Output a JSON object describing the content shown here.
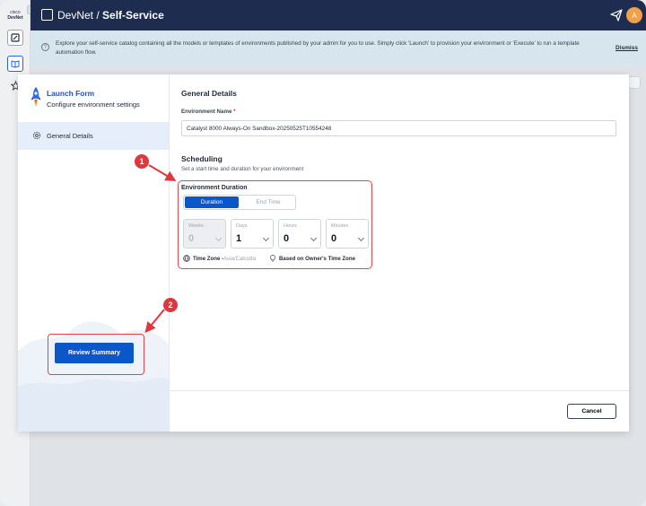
{
  "rail": {
    "logo_top": "cisco",
    "logo_bottom": "DevNet"
  },
  "header": {
    "app": "DevNet",
    "separator": " / ",
    "section": "Self-Service",
    "avatar_initial": "A"
  },
  "banner": {
    "text": "Explore your self-service catalog containing all the models or templates of environments published by your admin for you to use. Simply click 'Launch' to provision your environment or 'Execute' to run a template automation flow.",
    "dismiss": "Dismiss"
  },
  "sidebar": {
    "title": "Launch Form",
    "subtitle": "Configure environment settings",
    "nav_item": "General Details",
    "review_button": "Review Summary"
  },
  "main": {
    "section_title": "General Details",
    "env_name_label": "Environment Name",
    "required_mark": "*",
    "env_name_value": "Catalyst 8000 Always-On Sandbox-20250525T10554248",
    "scheduling_title": "Scheduling",
    "scheduling_sub": "Set a start time and duration for your environment",
    "duration_title": "Environment Duration",
    "tabs": {
      "duration": "Duration",
      "end_time": "End Time"
    },
    "selects": [
      {
        "label": "Weeks",
        "value": "0"
      },
      {
        "label": "Days",
        "value": "1"
      },
      {
        "label": "Hours",
        "value": "0"
      },
      {
        "label": "Minutes",
        "value": "0"
      }
    ],
    "timezone_label": "Time Zone - ",
    "timezone_value": "Asia/Calcutta",
    "owner_tz": "Based on Owner's Time Zone",
    "cancel": "Cancel"
  },
  "annotations": {
    "marker1": "1",
    "marker2": "2",
    "color": "#e0363c"
  },
  "colors": {
    "primary": "#0b56c8",
    "header": "#1d2c4f",
    "banner": "#d7e6ee",
    "highlight": "#e0464a"
  }
}
